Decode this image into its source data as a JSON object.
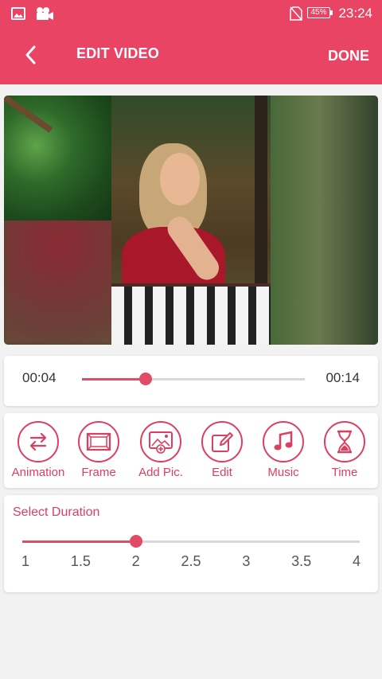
{
  "status_bar": {
    "time": "23:24",
    "battery": "45%",
    "icons": [
      "gallery-icon",
      "video-camera-icon",
      "no-sim-icon"
    ]
  },
  "header": {
    "title": "EDIT VIDEO",
    "done_label": "DONE",
    "back_icon": "chevron-left-icon"
  },
  "colors": {
    "accent": "#ea4464",
    "accent_text": "#dc3f5f"
  },
  "timeline": {
    "current": "00:04",
    "total": "00:14",
    "progress_fraction": 0.286
  },
  "tools": [
    {
      "label": "Animation",
      "icon": "swap-arrows-icon"
    },
    {
      "label": "Frame",
      "icon": "frame-icon"
    },
    {
      "label": "Add Pic.",
      "icon": "add-picture-icon"
    },
    {
      "label": "Edit",
      "icon": "edit-pencil-icon"
    },
    {
      "label": "Music",
      "icon": "music-note-icon"
    },
    {
      "label": "Time",
      "icon": "hourglass-icon"
    }
  ],
  "duration": {
    "title": "Select Duration",
    "ticks": [
      "1",
      "1.5",
      "2",
      "2.5",
      "3",
      "3.5",
      "4"
    ],
    "selected": 2
  }
}
